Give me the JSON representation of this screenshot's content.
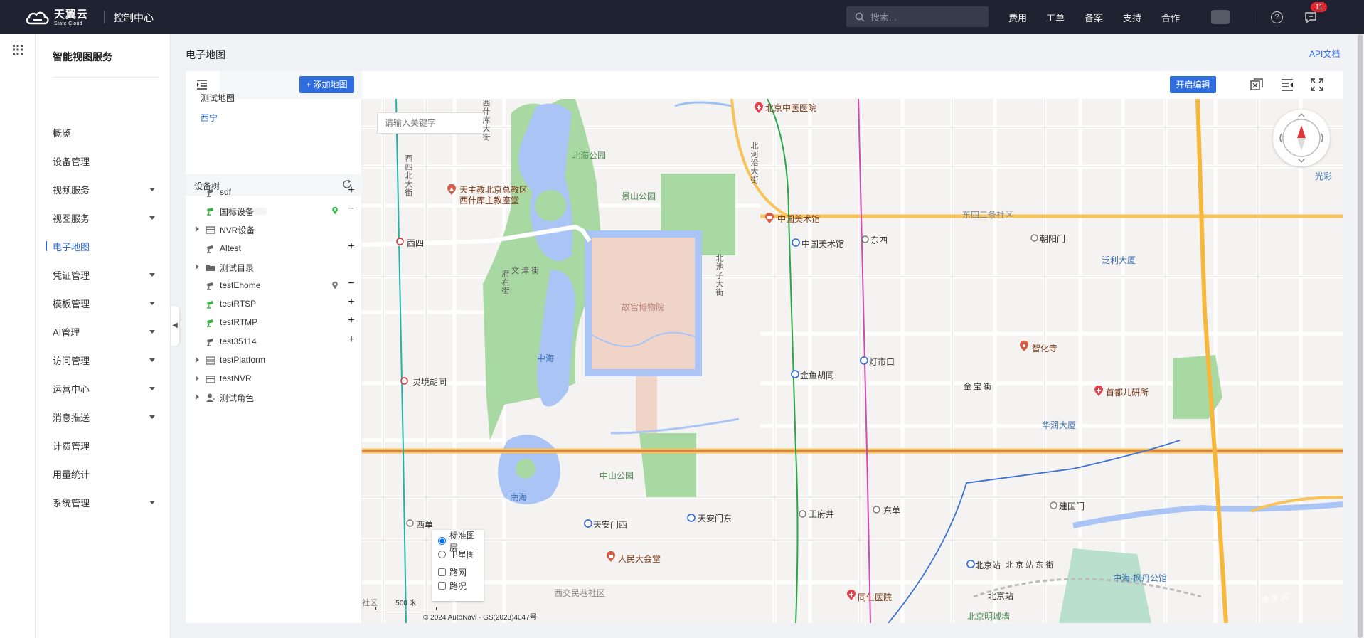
{
  "topbar": {
    "brand_cn": "天翼云",
    "brand_en": "State Cloud",
    "console_title": "控制中心",
    "search_placeholder": "搜索...",
    "nav": [
      "费用",
      "工单",
      "备案",
      "支持",
      "合作"
    ],
    "message_count": "11"
  },
  "sidebar": {
    "title": "智能视图服务",
    "items": [
      {
        "label": "概览",
        "has_submenu": false
      },
      {
        "label": "设备管理",
        "has_submenu": false
      },
      {
        "label": "视频服务",
        "has_submenu": true
      },
      {
        "label": "视图服务",
        "has_submenu": true
      },
      {
        "label": "电子地图",
        "has_submenu": false,
        "active": true
      },
      {
        "label": "凭证管理",
        "has_submenu": true
      },
      {
        "label": "模板管理",
        "has_submenu": true
      },
      {
        "label": "AI管理",
        "has_submenu": true
      },
      {
        "label": "访问管理",
        "has_submenu": true
      },
      {
        "label": "运营中心",
        "has_submenu": true
      },
      {
        "label": "消息推送",
        "has_submenu": true
      },
      {
        "label": "计费管理",
        "has_submenu": false
      },
      {
        "label": "用量统计",
        "has_submenu": false
      },
      {
        "label": "系统管理",
        "has_submenu": true
      }
    ]
  },
  "page": {
    "title": "电子地图",
    "api_doc_link": "API文档"
  },
  "tree_panel": {
    "add_map_button": "+ 添加地图",
    "maps": [
      {
        "label": "测试地图",
        "selected": false
      },
      {
        "label": "西宁",
        "selected": true
      }
    ],
    "device_tree_title": "设备树",
    "nodes": [
      {
        "label": "sdf",
        "icon": "camera-icon",
        "icon_color": "#666666",
        "expandable": false,
        "pin": false,
        "action": "+"
      },
      {
        "label": "国标设备",
        "icon": "camera-icon",
        "icon_color": "#3bb34a",
        "expandable": false,
        "pin": true,
        "pin_color": "#3bb34a",
        "action": "−"
      },
      {
        "label": "NVR设备",
        "icon": "nvr-icon",
        "icon_color": "#666666",
        "expandable": true,
        "pin": false,
        "action": ""
      },
      {
        "label": "Altest",
        "icon": "camera-icon",
        "icon_color": "#666666",
        "expandable": false,
        "pin": false,
        "action": "+"
      },
      {
        "label": "测试目录",
        "icon": "folder-icon",
        "icon_color": "#666666",
        "expandable": true,
        "pin": false,
        "action": ""
      },
      {
        "label": "testEhome",
        "icon": "camera-icon",
        "icon_color": "#666666",
        "expandable": false,
        "pin": true,
        "pin_color": "#777777",
        "action": "−"
      },
      {
        "label": "testRTSP",
        "icon": "camera-icon",
        "icon_color": "#3bb34a",
        "expandable": false,
        "pin": false,
        "action": "+"
      },
      {
        "label": "testRTMP",
        "icon": "camera-icon",
        "icon_color": "#3bb34a",
        "expandable": false,
        "pin": false,
        "action": "+"
      },
      {
        "label": "test35114",
        "icon": "camera-icon",
        "icon_color": "#666666",
        "expandable": false,
        "pin": false,
        "action": "+"
      },
      {
        "label": "testPlatform",
        "icon": "platform-icon",
        "icon_color": "#666666",
        "expandable": true,
        "pin": false,
        "action": ""
      },
      {
        "label": "testNVR",
        "icon": "nvr-icon",
        "icon_color": "#666666",
        "expandable": true,
        "pin": false,
        "action": ""
      },
      {
        "label": "测试角色",
        "icon": "user-role-icon",
        "icon_color": "#666666",
        "expandable": true,
        "pin": false,
        "action": ""
      }
    ]
  },
  "map_toolbar": {
    "edit_button": "开启编辑"
  },
  "map": {
    "search_placeholder": "请输入关键字",
    "labels": {
      "beihai_park": "北海公园",
      "jingshan_park": "景山公园",
      "palace_museum": "故宫博物院",
      "zhonghai": "中海",
      "nanhai": "南海",
      "zhongshan_park": "中山公园",
      "church": "天主教北京总教区\n西什库主教座堂",
      "beijing_tcm_hospital": "北京中医医院",
      "art_museum": "中国美术馆",
      "art_museum_station": "中国美术馆",
      "dongsi": "东四",
      "chaoyangmen": "朝阳门",
      "fanli_building": "泛利大厦",
      "zhihua_temple": "智化寺",
      "dengshikou": "灯市口",
      "jinyu_hutong": "金鱼胡同",
      "jinbao_street": "金 宝 街",
      "children_institute": "首都儿研所",
      "huarun_building": "华润大厦",
      "xisi": "西四",
      "lingjing_hutong": "灵境胡同",
      "xidan": "西单",
      "tiananmen_west": "天安门西",
      "tiananmen_east": "天安门东",
      "wangfujing": "王府井",
      "dongdan": "东单",
      "jianguomen": "建国门",
      "great_hall": "人民大会堂",
      "xijiaominxiang": "西交民巷社区",
      "beijing_station_subway": "北京站",
      "beijing_station_east_street": "北 京 站 东 街",
      "beijing_station": "北京站",
      "zhonghai_fengye": "中海·枫丹公馆",
      "tongren_hospital": "同仁医院",
      "mingcheng_wall": "北京明城墙",
      "guangcai": "光彩",
      "dongsi_ertiao": "东四二条社区",
      "wenjin_street": "文 津 街",
      "tonghui_river": "通 惠 河",
      "shequ": "社区",
      "xi_an_street": "西什库大街",
      "xisi_north": "西四北大街",
      "fuyou_street": "府右街",
      "beichizi": "北池子大街",
      "beiheyan": "北河沿大街"
    },
    "layers": {
      "standard": "标准图层",
      "satellite": "卫星图",
      "road_net": "路网",
      "traffic": "路况",
      "selected": "standard"
    },
    "scale": "500 米",
    "copyright": "© 2024 AutoNavi - GS(2023)4047号"
  }
}
